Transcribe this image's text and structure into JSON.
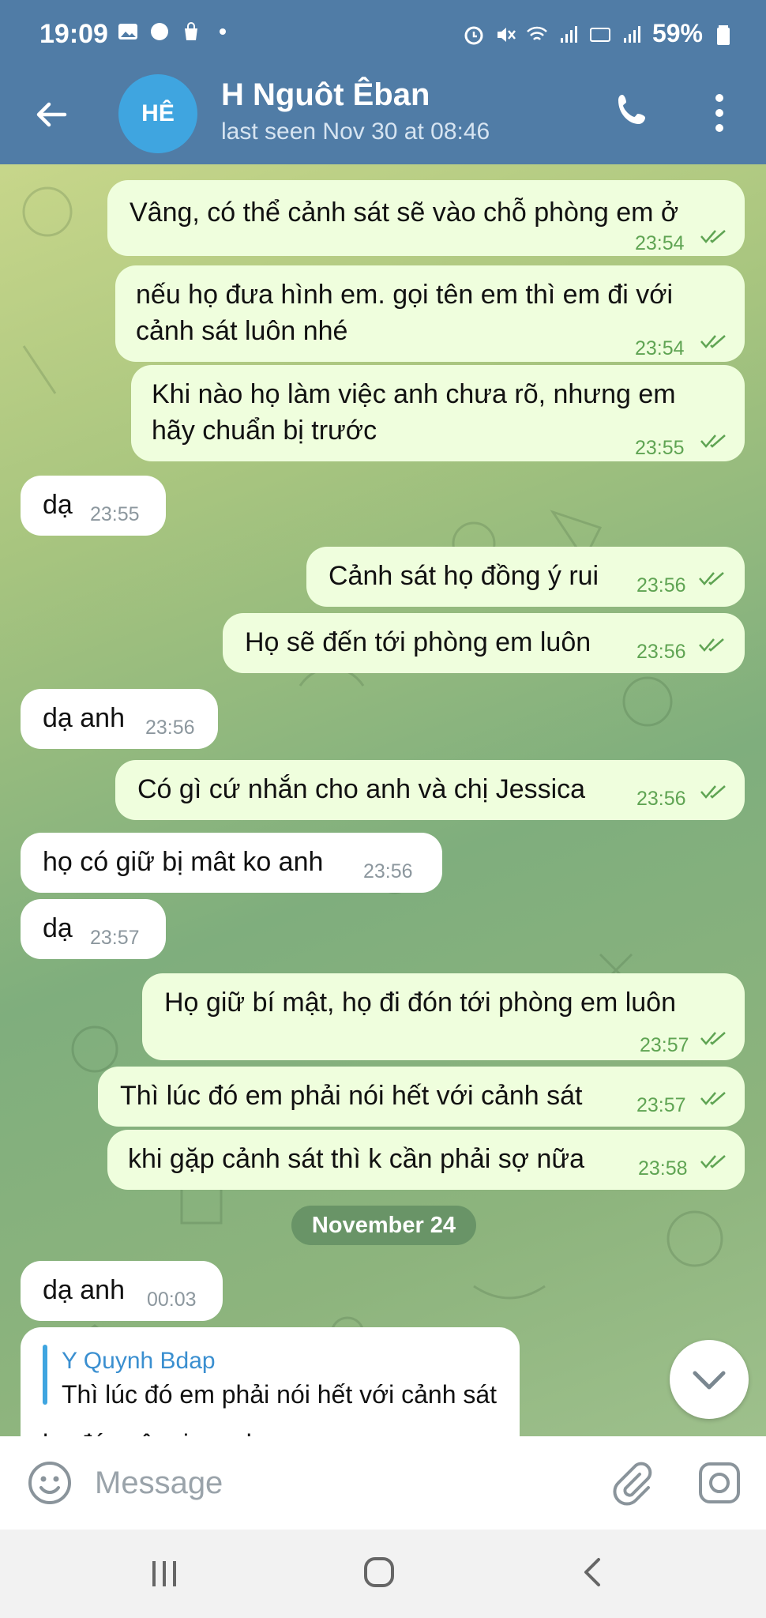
{
  "status_bar": {
    "time": "19:09",
    "battery": "59%"
  },
  "header": {
    "avatar_initials": "HÊ",
    "contact_name": "H Nguôt Êban",
    "last_seen": "last seen Nov 30 at 08:46"
  },
  "messages": [
    {
      "dir": "out",
      "lines": [
        "Vâng, có thể cảnh sát sẽ vào chỗ phòng em ở"
      ],
      "time": "23:54"
    },
    {
      "dir": "out",
      "lines": [
        "nếu họ đưa hình em. gọi tên em thì em đi với",
        "cảnh sát luôn nhé"
      ],
      "time": "23:54"
    },
    {
      "dir": "out",
      "lines": [
        "Khi nào họ làm việc anh chưa rõ, nhưng em",
        "hãy chuẩn bị trước"
      ],
      "time": "23:55"
    },
    {
      "dir": "in",
      "lines": [
        "dạ"
      ],
      "time": "23:55"
    },
    {
      "dir": "out",
      "lines": [
        "Cảnh sát họ đồng ý rui"
      ],
      "time": "23:56"
    },
    {
      "dir": "out",
      "lines": [
        "Họ sẽ đến tới phòng em luôn"
      ],
      "time": "23:56"
    },
    {
      "dir": "in",
      "lines": [
        "dạ anh"
      ],
      "time": "23:56"
    },
    {
      "dir": "out",
      "lines": [
        "Có gì cứ nhắn cho anh và chị Jessica"
      ],
      "time": "23:56"
    },
    {
      "dir": "in",
      "lines": [
        "họ có giữ bị mât ko anh"
      ],
      "time": "23:56"
    },
    {
      "dir": "in",
      "lines": [
        "dạ"
      ],
      "time": "23:57"
    },
    {
      "dir": "out",
      "lines": [
        "Họ giữ bí mật, họ đi đón tới phòng em luôn"
      ],
      "time": "23:57"
    },
    {
      "dir": "out",
      "lines": [
        "Thì lúc đó em phải nói hết với cảnh sát"
      ],
      "time": "23:57"
    },
    {
      "dir": "out",
      "lines": [
        "khi gặp cảnh sát thì k cần phải sợ nữa"
      ],
      "time": "23:58"
    }
  ],
  "date_separator": "November 24",
  "after_date": {
    "message": {
      "text": "dạ anh",
      "time": "00:03"
    },
    "reply": {
      "author": "Y Quynh Bdap",
      "quoted_text": "Thì lúc đó em phải nói hết với cảnh sát",
      "partial_text": "họ đón vô roi nơ chư"
    }
  },
  "input": {
    "placeholder": "Message"
  },
  "colors": {
    "header_bg": "#507ca6",
    "outgoing_bubble": "#effedd",
    "incoming_bubble": "#ffffff",
    "time_outgoing": "#5fa453",
    "avatar": "#3fa5e0"
  },
  "icons": [
    "back-arrow-icon",
    "phone-icon",
    "more-vert-icon",
    "emoji-icon",
    "attach-icon",
    "camera-icon",
    "chevron-down-icon",
    "double-check-icon"
  ]
}
